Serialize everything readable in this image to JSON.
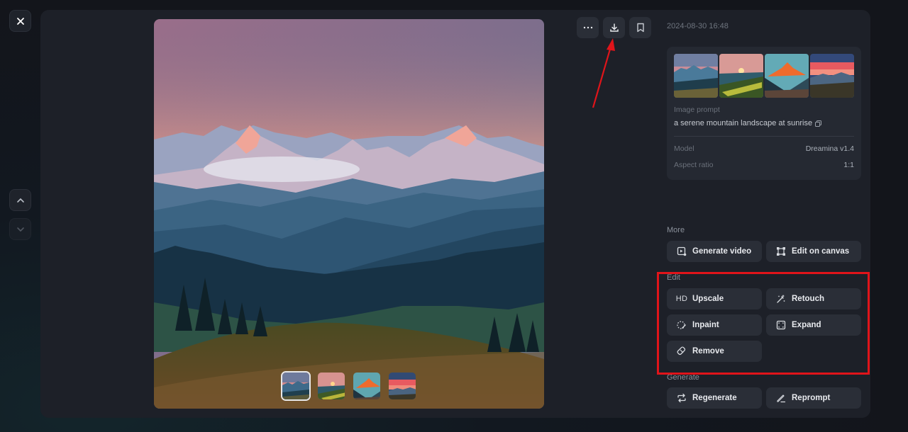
{
  "viewer": {
    "timestamp": "2024-08-30 16:48",
    "close_label": "Close",
    "selected_thumbnail_index": 0,
    "thumbnails_count": 4
  },
  "top_actions": {
    "more_icon": "more-horizontal-icon",
    "download_icon": "download-icon",
    "bookmark_icon": "bookmark-icon"
  },
  "info": {
    "prompt_label": "Image prompt",
    "prompt_text": "a serene mountain landscape at sunrise",
    "model_label": "Model",
    "model_value": "Dreamina v1.4",
    "aspect_label": "Aspect ratio",
    "aspect_value": "1:1"
  },
  "sections": {
    "more": {
      "label": "More",
      "buttons": [
        {
          "label": "Generate video",
          "icon": "video-icon"
        },
        {
          "label": "Edit on canvas",
          "icon": "canvas-icon"
        }
      ]
    },
    "edit": {
      "label": "Edit",
      "buttons": [
        {
          "label": "Upscale",
          "icon": "hd-icon",
          "icon_text": "HD"
        },
        {
          "label": "Retouch",
          "icon": "magic-wand-icon"
        },
        {
          "label": "Inpaint",
          "icon": "inpaint-brush-icon"
        },
        {
          "label": "Expand",
          "icon": "expand-icon"
        },
        {
          "label": "Remove",
          "icon": "eraser-icon"
        }
      ]
    },
    "generate": {
      "label": "Generate",
      "buttons": [
        {
          "label": "Regenerate",
          "icon": "refresh-icon"
        },
        {
          "label": "Reprompt",
          "icon": "pencil-icon"
        }
      ]
    }
  },
  "colors": {
    "panel_bg": "#1d2028",
    "button_bg": "#2a2e37",
    "annotation_red": "#e0141a"
  }
}
